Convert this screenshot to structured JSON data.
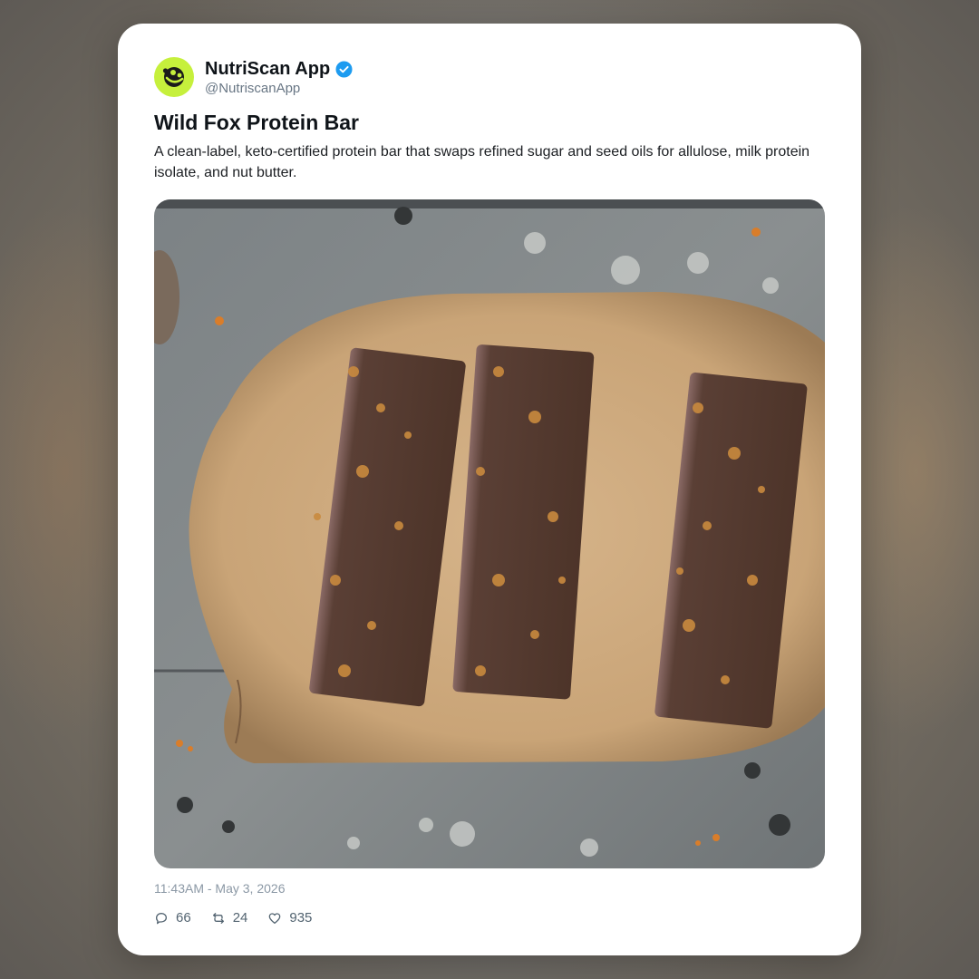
{
  "account": {
    "display_name": "NutriScan App",
    "handle": "@NutriscanApp",
    "verified": true,
    "avatar_color": "#c6f03c",
    "verified_color": "#1d9bf0"
  },
  "post": {
    "title": "Wild Fox Protein Bar",
    "body": "A clean-label, keto-certified protein bar that swaps refined sugar and seed oils for allulose, milk protein isolate, and nut butter.",
    "timestamp": "11:43AM - May 3, 2026",
    "image_icon": "photo-three-chocolate-protein-bars-on-wood-slice"
  },
  "engagement": {
    "replies": "66",
    "reposts": "24",
    "likes": "935",
    "reply_icon": "speech-bubble-icon",
    "repost_icon": "repost-arrows-icon",
    "like_icon": "heart-icon"
  }
}
